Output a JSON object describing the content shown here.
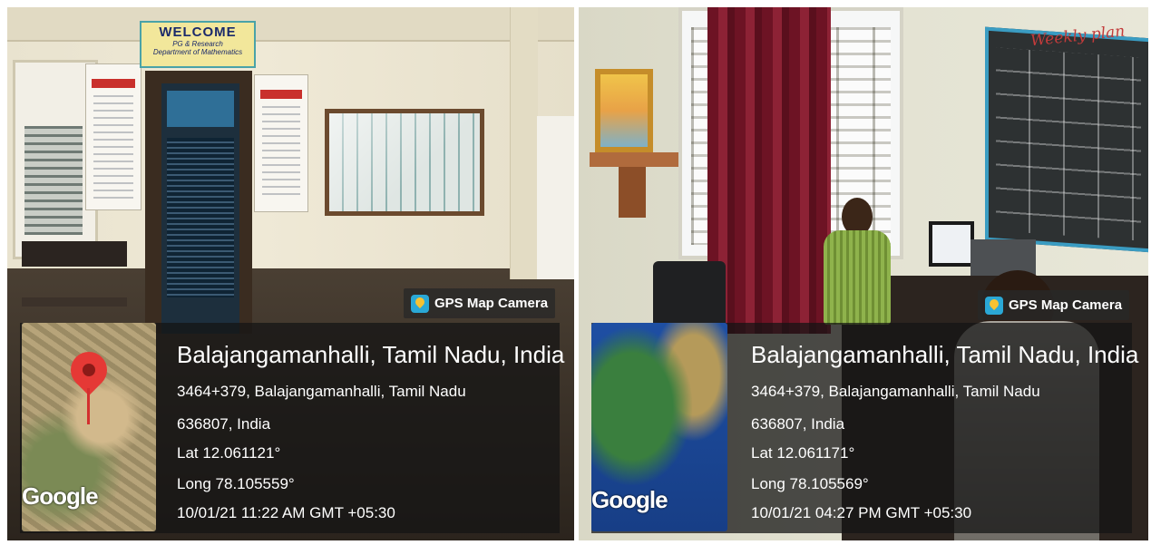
{
  "left_photo": {
    "scene": {
      "welcome_sign": {
        "title": "WELCOME",
        "subtitle_line1": "PG & Research",
        "subtitle_line2": "Department of Mathematics"
      }
    },
    "gps_badge": {
      "label": "GPS Map Camera",
      "icon": "gps-map-camera-icon"
    },
    "map": {
      "style": "satellite",
      "watermark": "Google",
      "pin_icon": "location-pin-icon",
      "pin_color": "#e53935"
    },
    "location": {
      "title": "Balajangamanhalli, Tamil Nadu, India",
      "address_line1": "3464+379, Balajangamanhalli, Tamil Nadu",
      "address_line2": "636807, India",
      "lat": "Lat 12.061121°",
      "long": "Long 78.105559°",
      "datetime": "10/01/21 11:22 AM GMT +05:30"
    }
  },
  "right_photo": {
    "scene": {
      "chalkboard_title": "Weekly plan"
    },
    "gps_badge": {
      "label": "GPS Map Camera",
      "icon": "gps-map-camera-icon"
    },
    "map": {
      "style": "globe",
      "watermark": "Google"
    },
    "location": {
      "title": "Balajangamanhalli, Tamil Nadu, India",
      "address_line1": "3464+379, Balajangamanhalli, Tamil Nadu",
      "address_line2": "636807, India",
      "lat": "Lat 12.061171°",
      "long": "Long 78.105569°",
      "datetime": "10/01/21 04:27 PM GMT +05:30"
    }
  },
  "colors": {
    "overlay_bg": "#141414",
    "badge_icon": "#2aa8d6",
    "pin": "#e53935"
  }
}
